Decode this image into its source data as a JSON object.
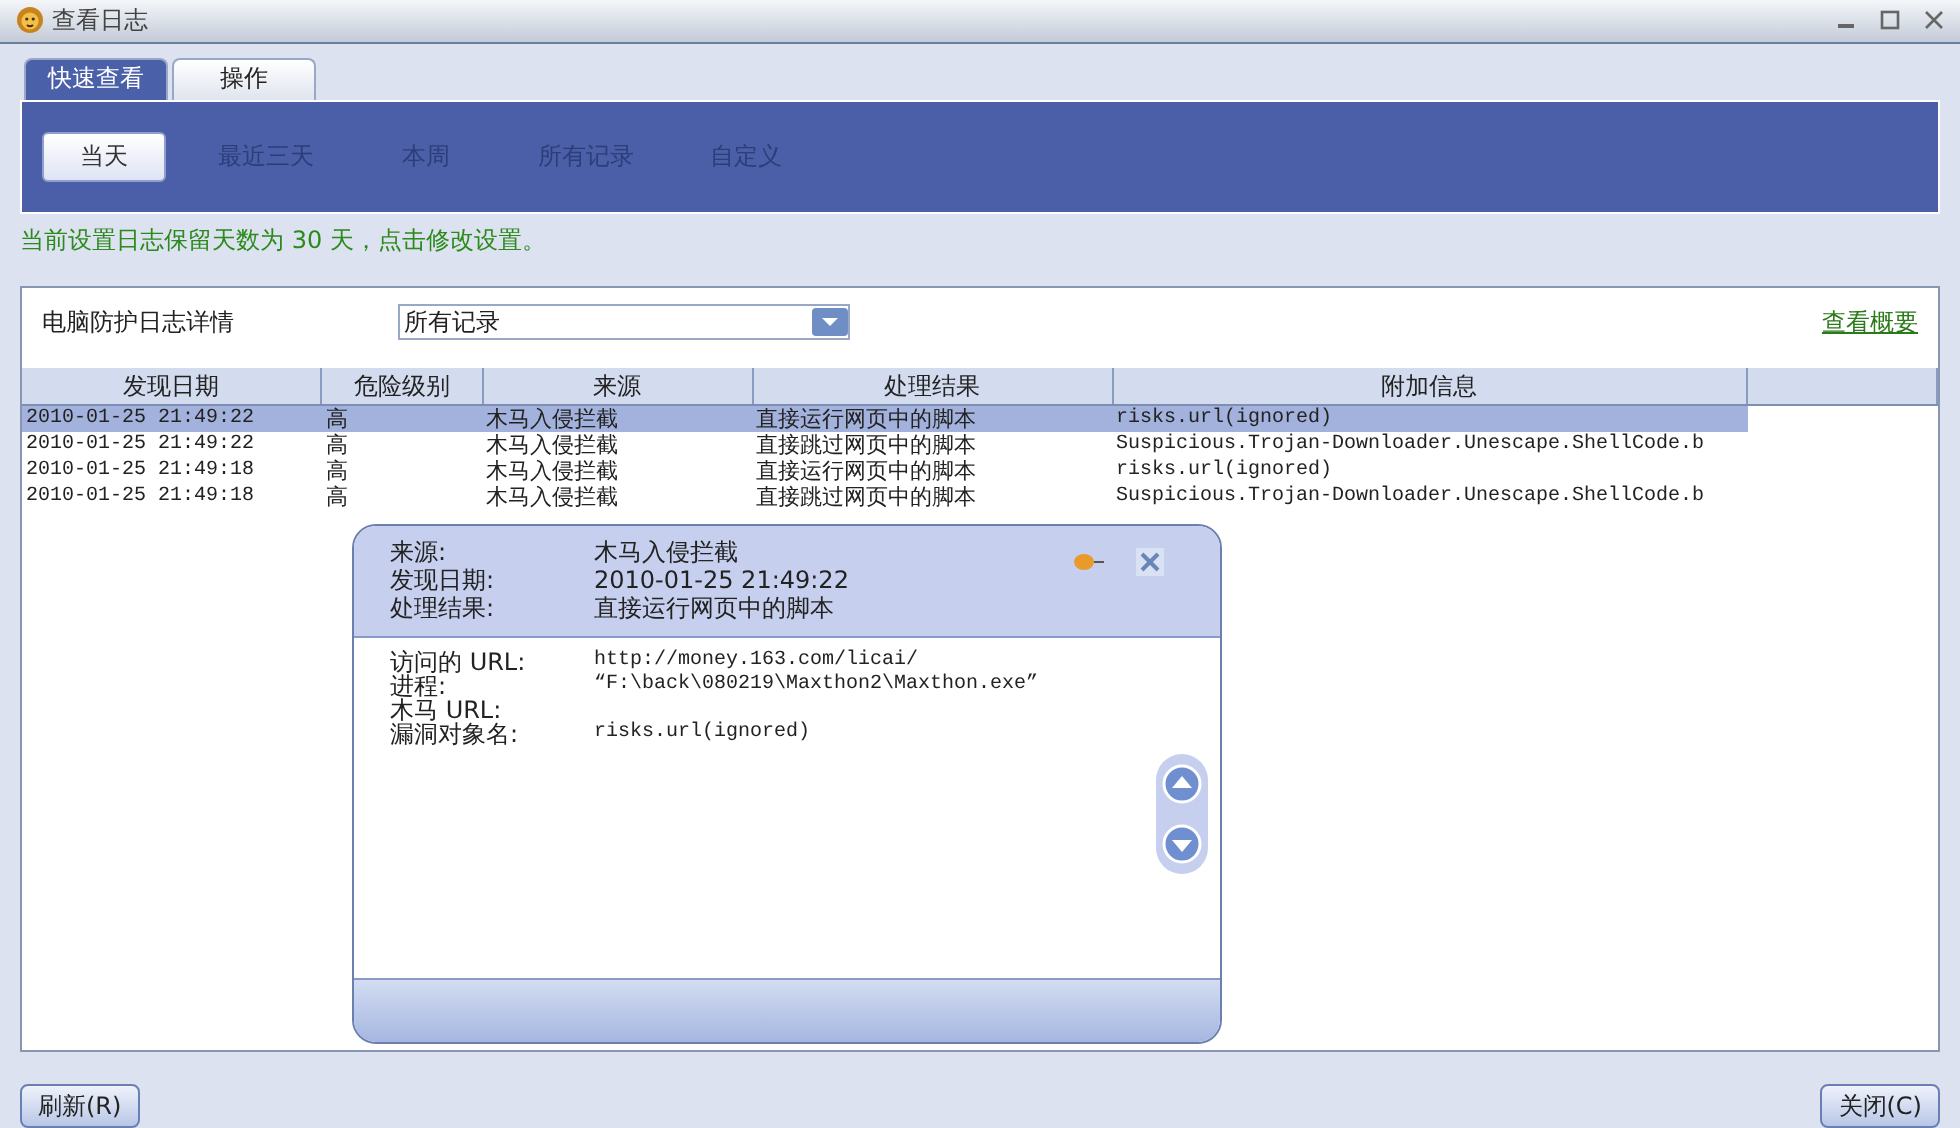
{
  "window": {
    "title": "查看日志"
  },
  "tabs": [
    {
      "label": "快速查看",
      "selected": true
    },
    {
      "label": "操作",
      "selected": false
    }
  ],
  "periods": [
    {
      "label": "当天",
      "selected": true
    },
    {
      "label": "最近三天",
      "selected": false
    },
    {
      "label": "本周",
      "selected": false
    },
    {
      "label": "所有记录",
      "selected": false
    },
    {
      "label": "自定义",
      "selected": false
    }
  ],
  "notice": "当前设置日志保留天数为 30 天，点击修改设置。",
  "section_label": "电脑防护日志详情",
  "filter": {
    "value": "所有记录"
  },
  "summary_link": "查看概要",
  "table": {
    "columns": [
      "发现日期",
      "危险级别",
      "来源",
      "处理结果",
      "附加信息"
    ],
    "rows": [
      {
        "cells": [
          "2010-01-25 21:49:22",
          "高",
          "木马入侵拦截",
          "直接运行网页中的脚本",
          "risks.url(ignored)"
        ],
        "selected": true
      },
      {
        "cells": [
          "2010-01-25 21:49:22",
          "高",
          "木马入侵拦截",
          "直接跳过网页中的脚本",
          "Suspicious.Trojan-Downloader.Unescape.ShellCode.b"
        ],
        "selected": false
      },
      {
        "cells": [
          "2010-01-25 21:49:18",
          "高",
          "木马入侵拦截",
          "直接运行网页中的脚本",
          "risks.url(ignored)"
        ],
        "selected": false
      },
      {
        "cells": [
          "2010-01-25 21:49:18",
          "高",
          "木马入侵拦截",
          "直接跳过网页中的脚本",
          "Suspicious.Trojan-Downloader.Unescape.ShellCode.b"
        ],
        "selected": false
      }
    ]
  },
  "popup": {
    "header": [
      {
        "label": "来源:",
        "value": "木马入侵拦截"
      },
      {
        "label": "发现日期:",
        "value": "2010-01-25 21:49:22"
      },
      {
        "label": "处理结果:",
        "value": "直接运行网页中的脚本"
      }
    ],
    "details": [
      {
        "label": "访问的 URL:",
        "value": "http://money.163.com/licai/"
      },
      {
        "label": "进程:",
        "value": "“F:\\back\\080219\\Maxthon2\\Maxthon.exe”"
      },
      {
        "label": "木马 URL:"
      },
      {
        "label": "漏洞对象名:",
        "value": "risks.url(ignored)"
      }
    ]
  },
  "buttons": {
    "refresh": "刷新(R)",
    "close": "关闭(C)"
  }
}
